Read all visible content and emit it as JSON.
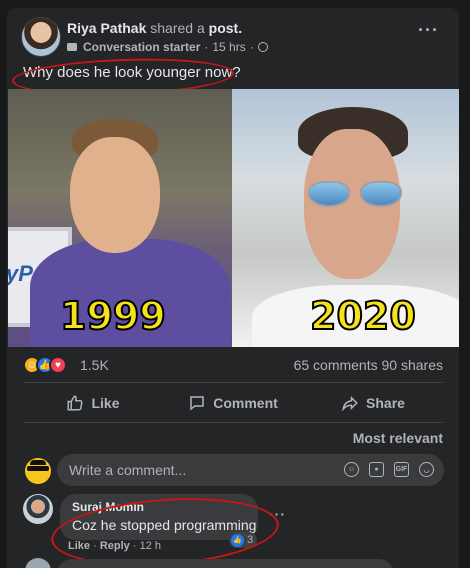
{
  "post": {
    "author": "Riya Pathak",
    "shared_text": "shared a",
    "shared_object": "post.",
    "badge": "Conversation starter",
    "time": "15 hrs",
    "body": "Why does he look younger now?",
    "more_label": "···"
  },
  "image": {
    "left_year": "1999",
    "right_year": "2020",
    "left_logo_text": "yPal"
  },
  "reactions": {
    "count": "1.5K",
    "comments": "65 comments",
    "shares": "90 shares",
    "types": [
      "haha-icon",
      "like-icon",
      "love-icon"
    ]
  },
  "actions": {
    "like": "Like",
    "comment": "Comment",
    "share": "Share"
  },
  "comments": {
    "sort_label": "Most relevant",
    "write_placeholder": "Write a comment...",
    "items": [
      {
        "author": "Suraj Momin",
        "text": "Coz he stopped programming",
        "like_label": "Like",
        "reply_label": "Reply",
        "time": "12 h",
        "reaction_count": "3"
      }
    ]
  },
  "colors": {
    "background": "#18191a",
    "card": "#242526",
    "annotation": "#c81616",
    "like_blue": "#2078f4",
    "year_yellow": "#f3e318"
  }
}
